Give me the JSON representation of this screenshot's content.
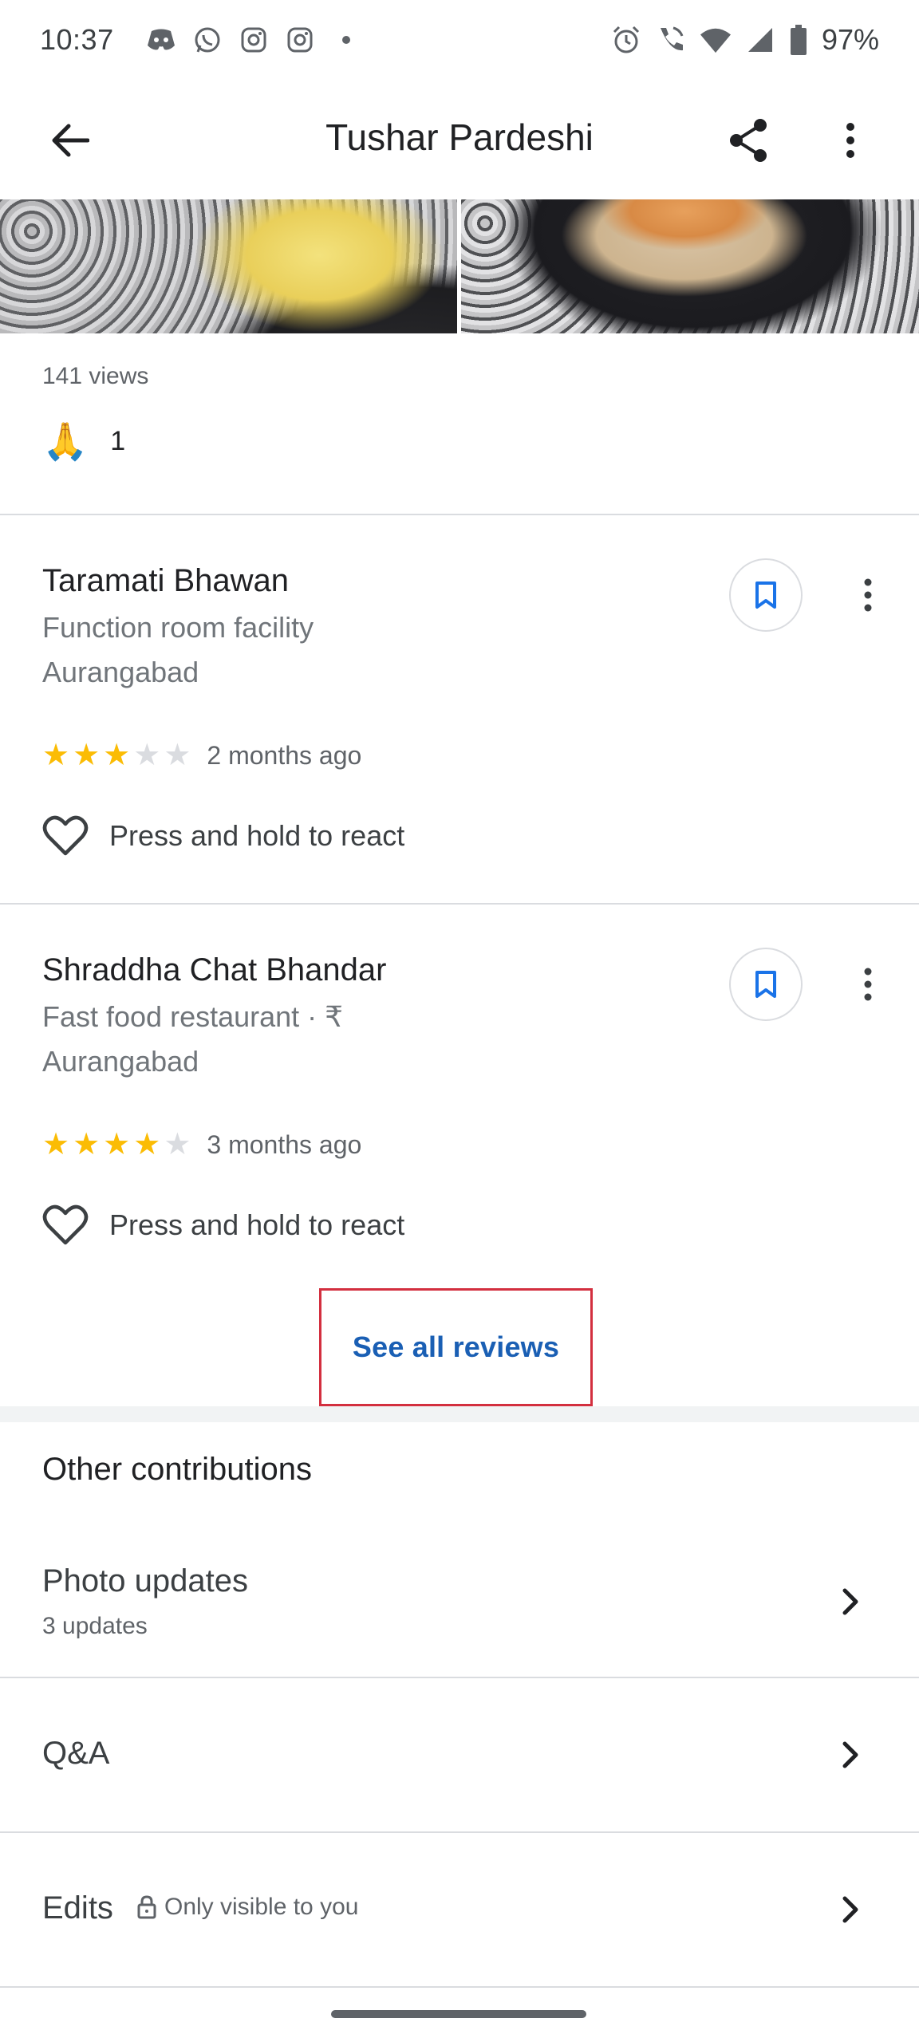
{
  "status_bar": {
    "time": "10:37",
    "battery": "97%",
    "left_icons": [
      "discord-icon",
      "whatsapp-icon",
      "instagram-icon",
      "instagram-icon",
      "dot-icon"
    ],
    "right_icons": [
      "alarm-icon",
      "wifi-call-icon",
      "wifi-icon",
      "signal-icon",
      "battery-icon"
    ]
  },
  "app_bar": {
    "title": "Tushar Pardeshi"
  },
  "post": {
    "views": "141 views",
    "reaction_emoji": "🙏",
    "reaction_count": "1"
  },
  "reviews": [
    {
      "place_name": "Taramati Bhawan",
      "place_type": "Function room facility",
      "location": "Aurangabad",
      "rating": 3,
      "max_rating": 5,
      "time": "2 months ago",
      "react_label": "Press and hold to react"
    },
    {
      "place_name": "Shraddha Chat Bhandar",
      "place_type": "Fast food restaurant · ₹",
      "location": "Aurangabad",
      "rating": 4,
      "max_rating": 5,
      "time": "3 months ago",
      "react_label": "Press and hold to react"
    }
  ],
  "see_all_reviews": "See all reviews",
  "other_contributions": {
    "title": "Other contributions",
    "items": [
      {
        "title": "Photo updates",
        "subtitle": "3 updates"
      },
      {
        "title": "Q&A"
      },
      {
        "title": "Edits",
        "note": "Only visible to you"
      }
    ]
  },
  "colors": {
    "accent_blue": "#1a5fb4",
    "star_yellow": "#fbbc04",
    "highlight_red": "#d32f3f"
  }
}
